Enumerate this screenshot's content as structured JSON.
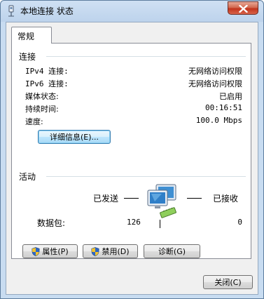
{
  "window": {
    "title": "本地连接 状态",
    "icon": "network-adapter-icon",
    "close_icon": "close-x-icon"
  },
  "tabs": [
    {
      "label": "常规",
      "selected": true
    }
  ],
  "connection": {
    "group_title": "连接",
    "rows": [
      {
        "label": "IPv4 连接:",
        "value": "无网络访问权限"
      },
      {
        "label": "IPv6 连接:",
        "value": "无网络访问权限"
      },
      {
        "label": "媒体状态:",
        "value": "已启用"
      },
      {
        "label": "持续时间:",
        "value": "00:16:51"
      },
      {
        "label": "速度:",
        "value": "100.0 Mbps"
      }
    ],
    "details_button": "详细信息(E)..."
  },
  "activity": {
    "group_title": "活动",
    "sent_label": "已发送",
    "received_label": "已接收",
    "packets_label": "数据包:",
    "sent_value": "126",
    "received_value": "0",
    "icon": "network-computers-icon"
  },
  "buttons": {
    "properties": "属性(P)",
    "disable": "禁用(D)",
    "diagnose": "诊断(G)",
    "close": "关闭(C)"
  },
  "colors": {
    "title_gradient_top": "#cfe0f3",
    "close_red": "#c2341c",
    "focus_blue": "#3c7fb1"
  }
}
